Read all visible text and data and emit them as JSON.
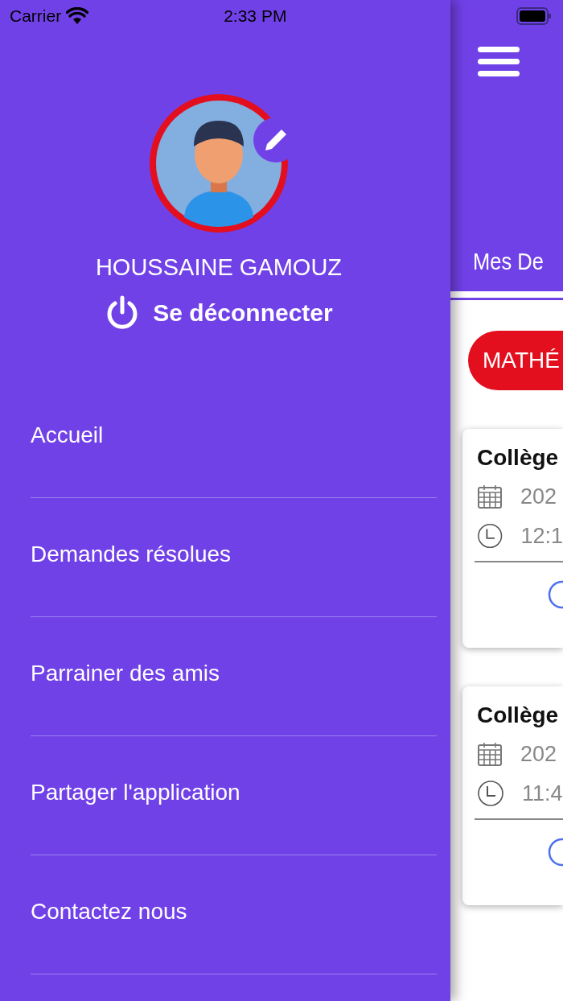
{
  "status_bar": {
    "carrier": "Carrier",
    "time": "2:33 PM"
  },
  "drawer": {
    "user_name": "HOUSSAINE GAMOUZ",
    "logout": "Se déconnecter",
    "menu": [
      {
        "label": "Accueil"
      },
      {
        "label": "Demandes résolues"
      },
      {
        "label": "Parrainer des amis"
      },
      {
        "label": "Partager l'application"
      },
      {
        "label": "Contactez nous"
      }
    ]
  },
  "main": {
    "tab": "Mes De",
    "chip": "MATHÉ",
    "cards": [
      {
        "title": "Collège",
        "date": "202",
        "time": "12:1"
      },
      {
        "title": "Collège",
        "date": "202",
        "time": "11:4"
      }
    ]
  }
}
